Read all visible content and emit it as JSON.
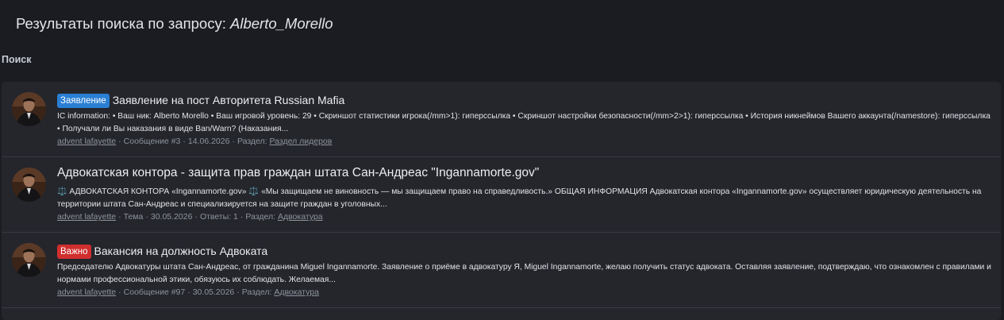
{
  "header": {
    "title_prefix": "Результаты поиска по запросу:",
    "query": "Alberto_Morello"
  },
  "section_label": "Поиск",
  "colors": {
    "badge_statement": "#2a7fd4",
    "badge_important": "#d12e2e",
    "background": "#1b1c21",
    "card": "#24262c"
  },
  "results": [
    {
      "badge": "Заявление",
      "title": "Заявление на пост Авторитета Russian Mafia",
      "snippet": "IC information: • Ваш ник: Alberto Morello • Ваш игровой уровень: 29 • Скриншот статистики игрока(/mm>1): гиперссылка • Скриншот настройки безопасности(/mm>2>1): гиперссылка • История никнеймов Вашего аккаунта(/namestore): гиперссылка • Получали ли Вы наказания в виде Ban/Warn? (Наказания...",
      "author": "advent lafayette",
      "kind": "Сообщение #3",
      "date": "14.06.2026",
      "section_prefix": "Раздел:",
      "section": "Раздел лидеров"
    },
    {
      "badge": "",
      "title": "Адвокатская контора - защита прав граждан штата Сан-Андреас \"Ingannamorte.gov\"",
      "snippet_emoji": "⚖️",
      "snippet": "АДВОКАТСКАЯ КОНТОРА «Ingannamorte.gov» ⚖️ «Мы защищаем не виновность — мы защищаем право на справедливость.» ОБЩАЯ ИНФОРМАЦИЯ Адвокатская контора «Ingannamorte.gov» осуществляет юридическую деятельность на территории штата Сан-Андреас и специализируется на защите граждан в уголовных...",
      "author": "advent lafayette",
      "kind": "Тема",
      "date": "30.05.2026",
      "replies": "Ответы: 1",
      "section_prefix": "Раздел:",
      "section": "Адвокатура"
    },
    {
      "badge": "Важно",
      "title": "Вакансия на должность Адвоката",
      "snippet": "Председателю Адвокатуры штата Сан-Андреас, от гражданина Miguel Ingannamorte. Заявление о приёме в адвокатуру Я, Miguel Ingannamorte, желаю получить статус адвоката. Оставляя заявление, подтверждаю, что ознакомлен с правилами и нормами профессиональной этики, обязуюсь их соблюдать. Желаемая...",
      "author": "advent lafayette",
      "kind": "Сообщение #97",
      "date": "30.05.2026",
      "section_prefix": "Раздел:",
      "section": "Адвокатура"
    }
  ]
}
